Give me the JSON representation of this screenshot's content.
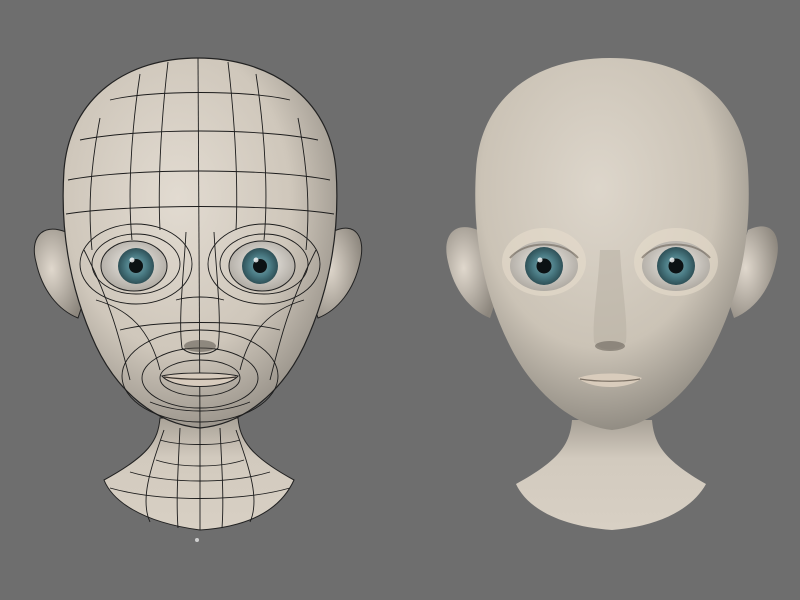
{
  "viewport": {
    "background": "#6e6e6e",
    "skin_color": "#d3cbc0",
    "skin_shadow": "#5b5650",
    "wire_color": "#1a1a1a",
    "iris_color": "#3f6f78",
    "pupil_color": "#0c1214",
    "lip_color": "#cdbfae"
  },
  "models": [
    {
      "name": "wireframe-head",
      "shading": "wireframe-on-shaded"
    },
    {
      "name": "smooth-head",
      "shading": "smooth-shaded"
    }
  ]
}
